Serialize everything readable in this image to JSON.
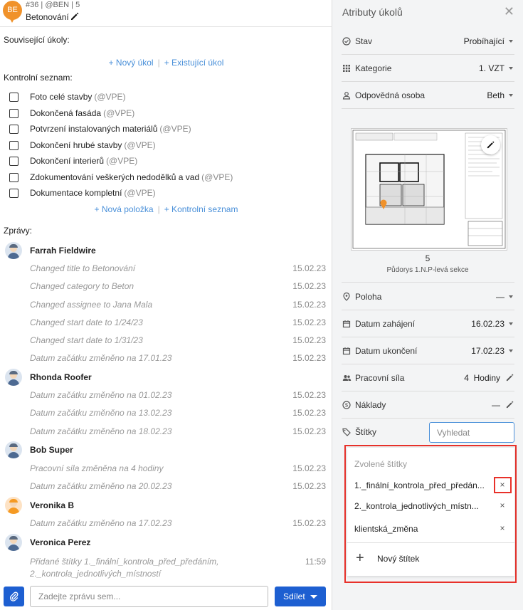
{
  "header": {
    "avatar_initials": "BE",
    "meta": "#36 | @BEN | 5",
    "title": "Betonování"
  },
  "related": {
    "label": "Související úkoly:",
    "new_task": "+ Nový úkol",
    "separator": "|",
    "existing_task": "+ Existující úkol"
  },
  "checklist": {
    "label": "Kontrolní seznam:",
    "items": [
      {
        "text": "Foto celé stavby",
        "tag": "(@VPE)"
      },
      {
        "text": "Dokončená fasáda",
        "tag": "(@VPE)"
      },
      {
        "text": "Potvrzení instalovaných materiálů",
        "tag": "(@VPE)"
      },
      {
        "text": "Dokončení hrubé stavby",
        "tag": "(@VPE)"
      },
      {
        "text": "Dokončení interierů",
        "tag": "(@VPE)"
      },
      {
        "text": "Zdokumentování veškerých nedodělků a vad",
        "tag": "(@VPE)"
      },
      {
        "text": "Dokumentace kompletní",
        "tag": "(@VPE)"
      }
    ],
    "new_item": "+ Nová položka",
    "separator": "|",
    "new_checklist": "+ Kontrolní seznam"
  },
  "messages": {
    "label": "Zprávy:",
    "groups": [
      {
        "user": "Farrah Fieldwire",
        "entries": [
          {
            "text": "Changed title to Betonování",
            "date": "15.02.23"
          },
          {
            "text": "Changed category to Beton",
            "date": "15.02.23"
          },
          {
            "text": "Changed assignee to Jana Mala",
            "date": "15.02.23"
          },
          {
            "text": "Changed start date to 1/24/23",
            "date": "15.02.23"
          },
          {
            "text": "Changed start date to 1/31/23",
            "date": "15.02.23"
          },
          {
            "text": "Datum začátku změněno na 17.01.23",
            "date": "15.02.23"
          }
        ]
      },
      {
        "user": "Rhonda Roofer",
        "entries": [
          {
            "text": "Datum začátku změněno na 01.02.23",
            "date": "15.02.23"
          },
          {
            "text": "Datum začátku změněno na 13.02.23",
            "date": "15.02.23"
          },
          {
            "text": "Datum začátku změněno na 18.02.23",
            "date": "15.02.23"
          }
        ]
      },
      {
        "user": "Bob Super",
        "entries": [
          {
            "text": "Pracovní síla změněna na 4 hodiny",
            "date": "15.02.23"
          },
          {
            "text": "Datum začátku změněno na 20.02.23",
            "date": "15.02.23"
          }
        ]
      },
      {
        "user": "Veronika B",
        "entries": [
          {
            "text": "Datum začátku změněno na 17.02.23",
            "date": "15.02.23"
          }
        ]
      },
      {
        "user": "Veronica Perez",
        "entries": [
          {
            "text_line1": "Přidané štítky 1._finální_kontrola_před_předáním,",
            "text_line2": "2._kontrola_jednotlivých_místností",
            "date": "11:59"
          }
        ]
      }
    ]
  },
  "composer": {
    "placeholder": "Zadejte zprávu sem...",
    "share_label": "Sdílet"
  },
  "panel": {
    "title": "Atributy úkolů",
    "status": {
      "label": "Stav",
      "value": "Probíhající"
    },
    "category": {
      "label": "Kategorie",
      "value": "1. VZT"
    },
    "assignee": {
      "label": "Odpovědná osoba",
      "value": "Beth"
    },
    "plan": {
      "number": "5",
      "name": "Půdorys 1.N.P-levá sekce"
    },
    "location": {
      "label": "Poloha",
      "value": "—"
    },
    "start_date": {
      "label": "Datum zahájení",
      "value": "16.02.23"
    },
    "end_date": {
      "label": "Datum ukončení",
      "value": "17.02.23"
    },
    "manpower": {
      "label": "Pracovní síla",
      "value": "4",
      "unit": "Hodiny"
    },
    "cost": {
      "label": "Náklady",
      "value": "—"
    },
    "tags": {
      "label": "Štítky",
      "search_placeholder": "Vyhledat"
    }
  },
  "tag_dropdown": {
    "heading": "Zvolené štítky",
    "selected": [
      "1._finální_kontrola_před_předán...",
      "2._kontrola_jednotlivých_místn...",
      "klientská_změna"
    ],
    "remove_symbol": "×",
    "new_tag_label": "Nový štítek"
  },
  "colors": {
    "accent": "#1d5fd1",
    "link": "#4a90d9",
    "highlight": "#e8312a",
    "avatar": "#f0922b"
  }
}
